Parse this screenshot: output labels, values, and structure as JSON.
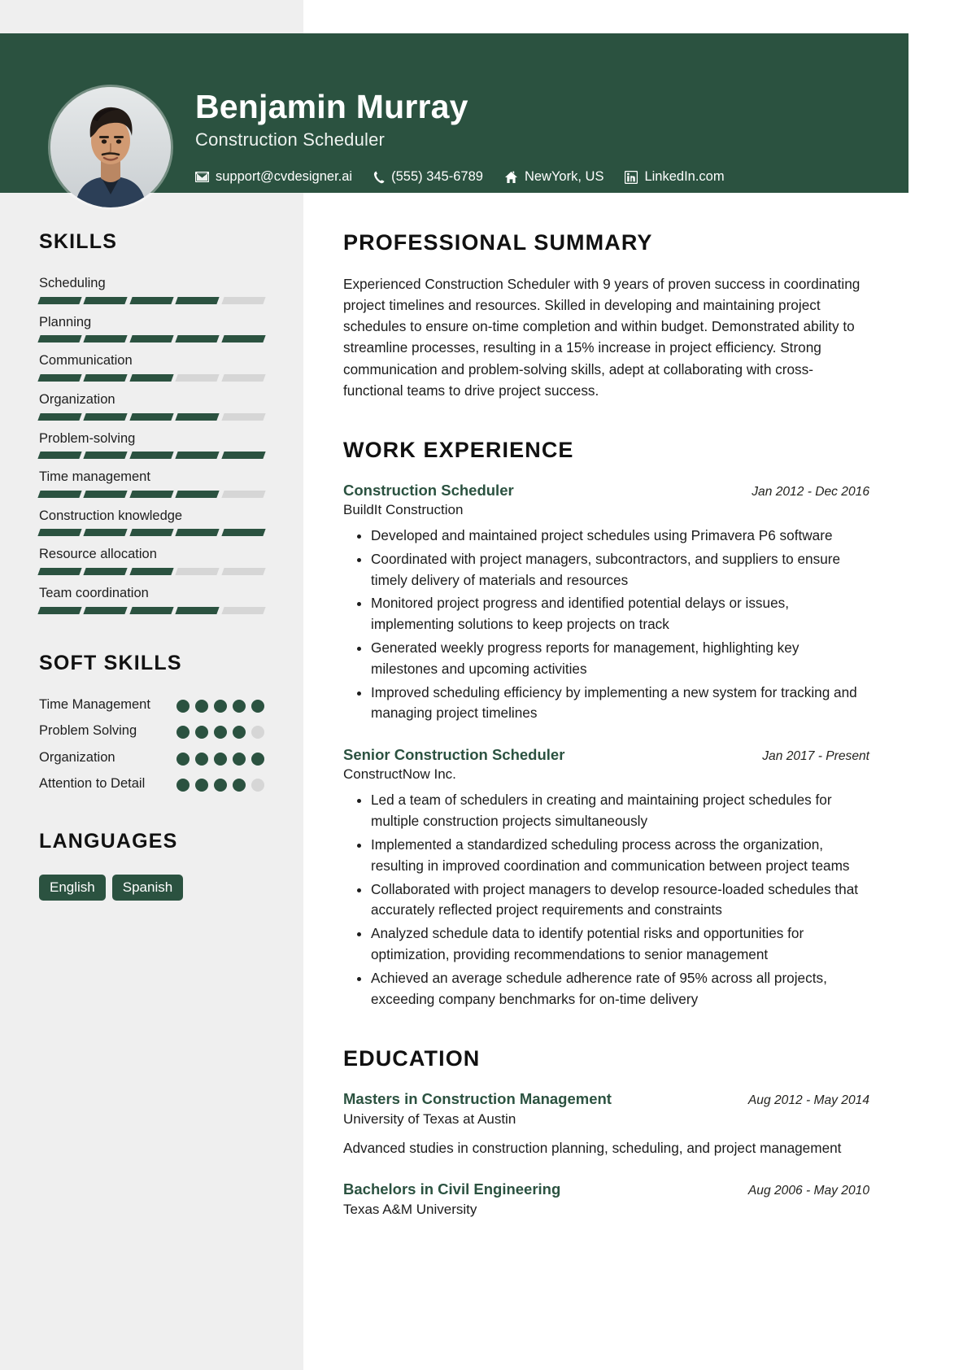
{
  "theme": {
    "accent": "#2b5240",
    "sidebar_bg": "#efefef",
    "page_bg": "#ffffff",
    "muted_bar": "#d6d6d6"
  },
  "header": {
    "name": "Benjamin Murray",
    "job_title": "Construction Scheduler",
    "avatar_alt": "profile-photo",
    "contacts": [
      {
        "icon": "envelope-icon",
        "text": "support@cvdesigner.ai"
      },
      {
        "icon": "phone-icon",
        "text": "(555) 345-6789"
      },
      {
        "icon": "home-icon",
        "text": "NewYork, US"
      },
      {
        "icon": "linkedin-icon",
        "text": "LinkedIn.com"
      }
    ]
  },
  "sidebar": {
    "skills_heading": "SKILLS",
    "skills": [
      {
        "label": "Scheduling",
        "level": 4,
        "max": 5
      },
      {
        "label": "Planning",
        "level": 5,
        "max": 5
      },
      {
        "label": "Communication",
        "level": 3,
        "max": 5
      },
      {
        "label": "Organization",
        "level": 4,
        "max": 5
      },
      {
        "label": "Problem-solving",
        "level": 5,
        "max": 5
      },
      {
        "label": "Time management",
        "level": 4,
        "max": 5
      },
      {
        "label": "Construction knowledge",
        "level": 5,
        "max": 5
      },
      {
        "label": "Resource allocation",
        "level": 3,
        "max": 5
      },
      {
        "label": "Team coordination",
        "level": 4,
        "max": 5
      }
    ],
    "soft_skills_heading": "SOFT SKILLS",
    "soft_skills": [
      {
        "label": "Time Management",
        "level": 5,
        "max": 5
      },
      {
        "label": "Problem Solving",
        "level": 4,
        "max": 5
      },
      {
        "label": "Organization",
        "level": 5,
        "max": 5
      },
      {
        "label": "Attention to Detail",
        "level": 4,
        "max": 5
      }
    ],
    "languages_heading": "LANGUAGES",
    "languages": [
      "English",
      "Spanish"
    ]
  },
  "main": {
    "summary_heading": "PROFESSIONAL SUMMARY",
    "summary_text": "Experienced Construction Scheduler with 9 years of proven success in coordinating project timelines and resources. Skilled in developing and maintaining project schedules to ensure on-time completion and within budget. Demonstrated ability to streamline processes, resulting in a 15% increase in project efficiency. Strong communication and problem-solving skills, adept at collaborating with cross-functional teams to drive project success.",
    "experience_heading": "WORK EXPERIENCE",
    "experience": [
      {
        "title": "Construction Scheduler",
        "date": "Jan 2012 - Dec 2016",
        "org": "BuildIt Construction",
        "bullets": [
          "Developed and maintained project schedules using Primavera P6 software",
          "Coordinated with project managers, subcontractors, and suppliers to ensure timely delivery of materials and resources",
          "Monitored project progress and identified potential delays or issues, implementing solutions to keep projects on track",
          "Generated weekly progress reports for management, highlighting key milestones and upcoming activities",
          "Improved scheduling efficiency by implementing a new system for tracking and managing project timelines"
        ]
      },
      {
        "title": "Senior Construction Scheduler",
        "date": "Jan 2017 - Present",
        "org": "ConstructNow Inc.",
        "bullets": [
          "Led a team of schedulers in creating and maintaining project schedules for multiple construction projects simultaneously",
          "Implemented a standardized scheduling process across the organization, resulting in improved coordination and communication between project teams",
          "Collaborated with project managers to develop resource-loaded schedules that accurately reflected project requirements and constraints",
          "Analyzed schedule data to identify potential risks and opportunities for optimization, providing recommendations to senior management",
          "Achieved an average schedule adherence rate of 95% across all projects, exceeding company benchmarks for on-time delivery"
        ]
      }
    ],
    "education_heading": "EDUCATION",
    "education": [
      {
        "degree": "Masters in Construction Management",
        "date": "Aug 2012 - May 2014",
        "school": "University of Texas at Austin",
        "desc": "Advanced studies in construction planning, scheduling, and project management"
      },
      {
        "degree": "Bachelors in Civil Engineering",
        "date": "Aug 2006 - May 2010",
        "school": "Texas A&M University",
        "desc": ""
      }
    ]
  }
}
